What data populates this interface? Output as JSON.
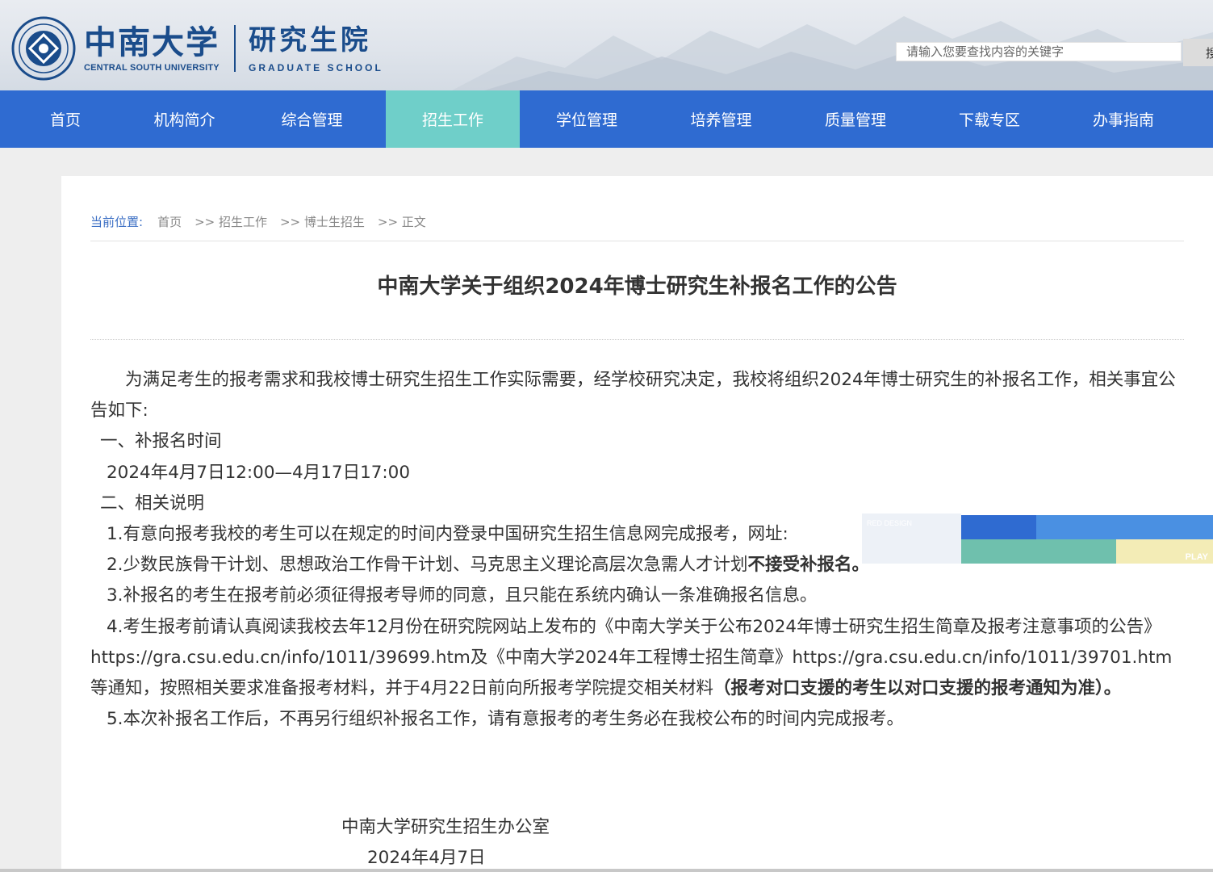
{
  "header": {
    "logo_cn": "中南大学",
    "logo_en": "CENTRAL SOUTH UNIVERSITY",
    "school_cn": "研究生院",
    "school_en": "GRADUATE SCHOOL",
    "search_placeholder": "请输入您要查找内容的关键字",
    "search_button": "搜"
  },
  "nav": {
    "items": [
      "首页",
      "机构简介",
      "综合管理",
      "招生工作",
      "学位管理",
      "培养管理",
      "质量管理",
      "下载专区",
      "办事指南"
    ],
    "active_index": 3
  },
  "breadcrumb": {
    "label": "当前位置:",
    "items": [
      "首页",
      ">> 招生工作",
      ">> 博士生招生",
      ">> 正文"
    ]
  },
  "article": {
    "title": "中南大学关于组织2024年博士研究生补报名工作的公告",
    "intro": "为满足考生的报考需求和我校博士研究生招生工作实际需要，经学校研究决定，我校将组织2024年博士研究生的补报名工作，相关事宜公告如下:",
    "sec1_heading": "一、补报名时间",
    "sec1_time": "2024年4月7日12:00—4月17日17:00",
    "sec2_heading": "二、相关说明",
    "item1": "1.有意向报考我校的考生可以在规定的时间内登录中国研究生招生信息网完成报考，网址:",
    "item2_a": "2.少数民族骨干计划、思想政治工作骨干计划、马克思主义理论高层次急需人才计划",
    "item2_b": "不接受补报名。",
    "item3": "3.补报名的考生在报考前必须征得报考导师的同意，且只能在系统内确认一条准确报名信息。",
    "item4_a": "4.考生报考前请认真阅读我校去年12月份在研究院网站上发布的《中南大学关于公布2024年博士研究生招生简章及报考注意事项的公告》https://gra.csu.edu.cn/info/1011/39699.htm及《中南大学2024年工程博士招生简章》https://gra.csu.edu.cn/info/1011/39701.htm等通知，按照相关要求准备报考材料，并于4月22日前向所报考学院提交相关材料",
    "item4_b": "（报考对口支援的考生以对口支援的报考通知为准）。",
    "item5": "5.本次补报名工作后，不再另行组织补报名工作，请有意报考的考生务必在我校公布的时间内完成报考。",
    "signature_org": "中南大学研究生招生办公室",
    "signature_date": "2024年4月7日"
  },
  "overlay_banner": {
    "text_small": "RED DESIGN",
    "text_play": "PLAY"
  },
  "colors": {
    "nav_bg": "#2f6bd1",
    "nav_active": "#6fcfc9",
    "brand": "#1a4c8b",
    "breadcrumb_label": "#3c6fc4"
  }
}
